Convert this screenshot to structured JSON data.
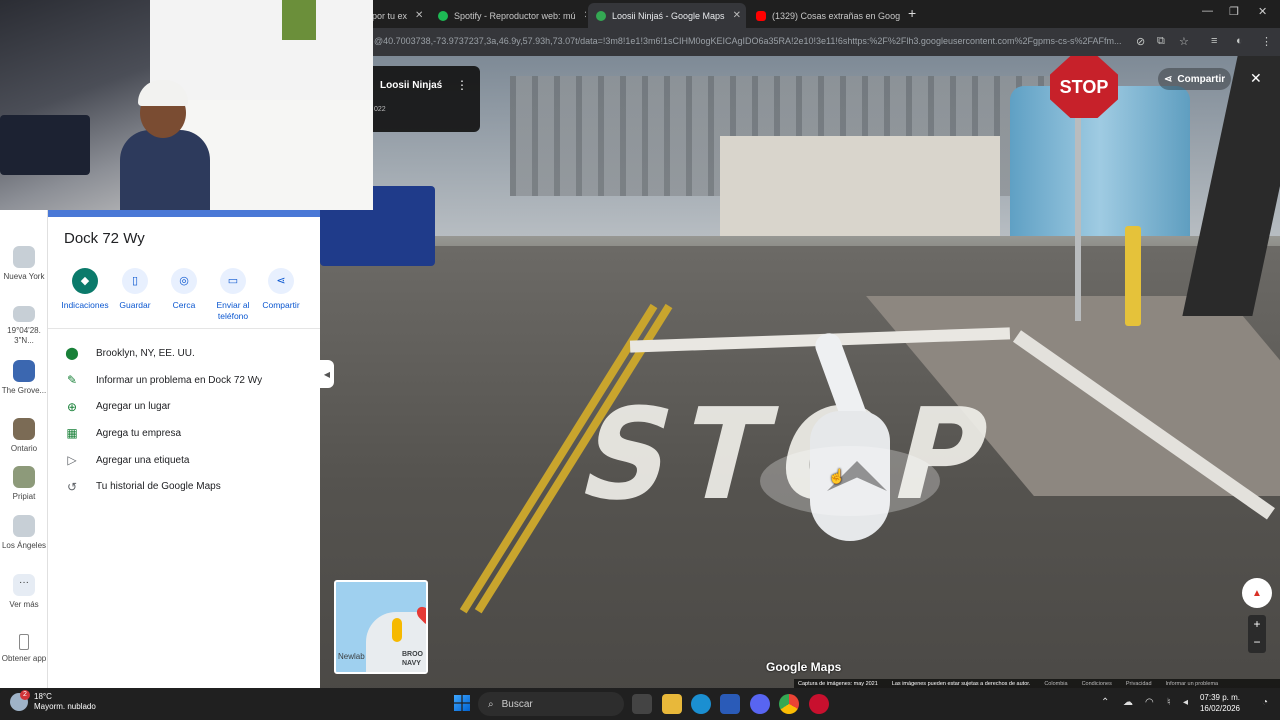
{
  "browser": {
    "tabs": [
      {
        "label": "por tu ex",
        "active": false
      },
      {
        "label": "Spotify - Reproductor web: mú",
        "active": false
      },
      {
        "label": "Loosii Ninjaś - Google Maps",
        "active": true
      },
      {
        "label": "(1329) Cosas extrañas en Goog",
        "active": false
      }
    ],
    "url": "@40.7003738,-73.9737237,3a,46.9y,57.93h,73.07t/data=!3m8!1e1!3m6!1sCIHM0ogKEICAgIDO6a35RA!2e10!3e11!6shttps:%2F%2Flh3.googleusercontent.com%2Fgpms-cs-s%2FAFfm..."
  },
  "streetview": {
    "title": "Loosii Ninjaś",
    "date": "022",
    "share_label": "Compartir",
    "stop_sign": "STOP",
    "road_text": "STOP",
    "minimap_labels": [
      "Newlab",
      "BROO NAVY"
    ],
    "brand": "Google Maps",
    "footer": [
      "Captura de imágenes: may 2021",
      "Las imágenes pueden estar sujetas a derechos de autor.",
      "Colombia",
      "Condiciones",
      "Privacidad",
      "Informar un problema"
    ]
  },
  "rail": [
    {
      "label": "Nueva York"
    },
    {
      "label": "19°04'28. 3\"N..."
    },
    {
      "label": "The Grove..."
    },
    {
      "label": "Ontario"
    },
    {
      "label": "Pripiat"
    },
    {
      "label": "Los Ángeles"
    },
    {
      "label": "Ver más"
    },
    {
      "label": "Obtener app"
    }
  ],
  "panel": {
    "title": "Dock 72 Wy",
    "actions": [
      {
        "label": "Indicaciones",
        "icon": "directions-icon"
      },
      {
        "label": "Guardar",
        "icon": "bookmark-icon"
      },
      {
        "label": "Cerca",
        "icon": "nearby-icon"
      },
      {
        "label": "Enviar al teléfono",
        "icon": "phone-icon"
      },
      {
        "label": "Compartir",
        "icon": "share-icon"
      }
    ],
    "items": [
      {
        "label": "Brooklyn, NY, EE. UU.",
        "icon": "location-pin-icon"
      },
      {
        "label": "Informar un problema en Dock 72 Wy",
        "icon": "pencil-icon"
      },
      {
        "label": "Agregar un lugar",
        "icon": "add-place-icon"
      },
      {
        "label": "Agrega tu empresa",
        "icon": "store-icon"
      },
      {
        "label": "Agregar una etiqueta",
        "icon": "label-icon"
      },
      {
        "label": "Tu historial de Google Maps",
        "icon": "history-icon"
      }
    ]
  },
  "taskbar": {
    "weather_temp": "18°C",
    "weather_desc": "Mayorm. nublado",
    "weather_badge": "2",
    "search_placeholder": "Buscar",
    "time": "07:39 p. m.",
    "date": "16/02/2026"
  }
}
